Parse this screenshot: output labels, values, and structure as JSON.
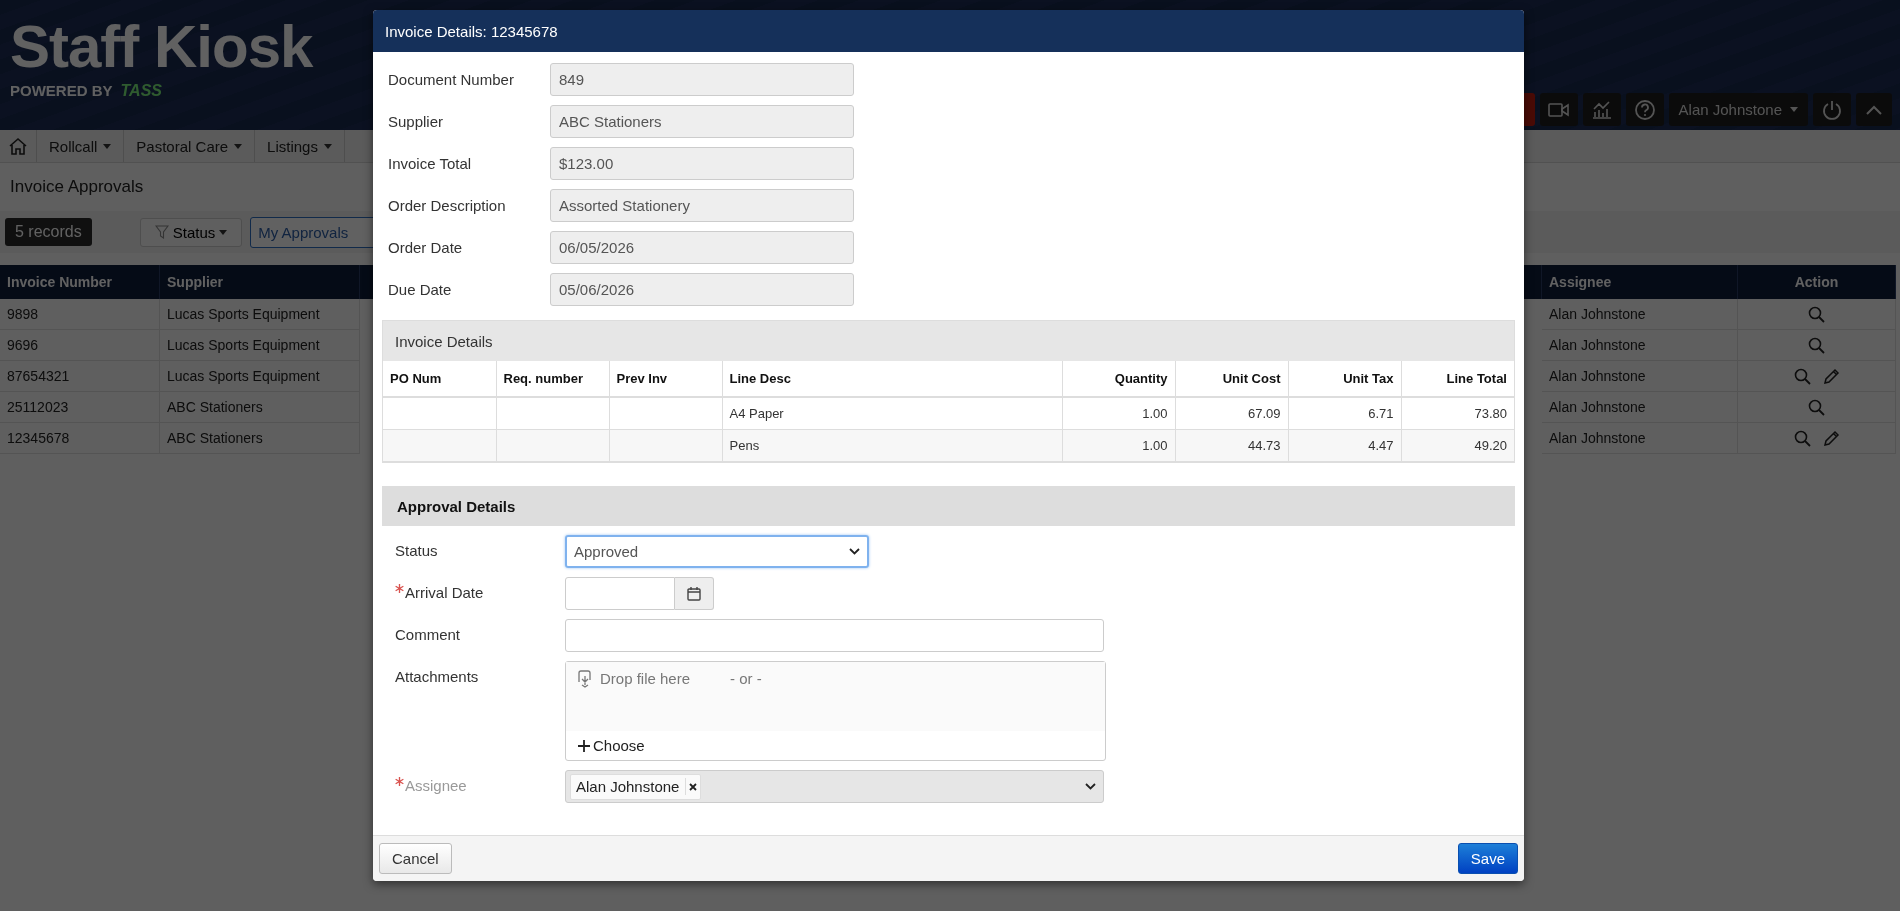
{
  "header": {
    "logo": "Staff Kiosk",
    "tagline": "POWERED BY",
    "brand": "TASS",
    "user": "Alan Johnstone"
  },
  "nav": [
    {
      "label": "Rollcall"
    },
    {
      "label": "Pastoral Care"
    },
    {
      "label": "Listings"
    }
  ],
  "page": {
    "title": "Invoice Approvals",
    "record_count": "5 records",
    "filter": "Status",
    "view": "My Approvals"
  },
  "table": {
    "columns": [
      "Invoice Number",
      "Supplier",
      "Assignee",
      "Action"
    ],
    "rows": [
      {
        "invoice": "9898",
        "supplier": "Lucas Sports Equipment",
        "assignee": "Alan Johnstone",
        "editable": false
      },
      {
        "invoice": "9696",
        "supplier": "Lucas Sports Equipment",
        "assignee": "Alan Johnstone",
        "editable": false
      },
      {
        "invoice": "87654321",
        "supplier": "Lucas Sports Equipment",
        "assignee": "Alan Johnstone",
        "editable": true
      },
      {
        "invoice": "25112023",
        "supplier": "ABC Stationers",
        "assignee": "Alan Johnstone",
        "editable": false
      },
      {
        "invoice": "12345678",
        "supplier": "ABC Stationers",
        "assignee": "Alan Johnstone",
        "editable": true
      }
    ]
  },
  "dialog": {
    "title": "Invoice Details: 12345678",
    "fields": [
      {
        "label": "Document Number",
        "value": "849"
      },
      {
        "label": "Supplier",
        "value": "ABC Stationers"
      },
      {
        "label": "Invoice Total",
        "value": "$123.00"
      },
      {
        "label": "Order Description",
        "value": "Assorted Stationery"
      },
      {
        "label": "Order Date",
        "value": "06/05/2026"
      },
      {
        "label": "Due Date",
        "value": "05/06/2026"
      }
    ],
    "invoice_details": {
      "title": "Invoice Details",
      "columns": [
        {
          "label": "PO Num",
          "kind": "text"
        },
        {
          "label": "Req. number",
          "kind": "text"
        },
        {
          "label": "Prev Inv",
          "kind": "text"
        },
        {
          "label": "Line Desc",
          "kind": "text"
        },
        {
          "label": "Quantity",
          "kind": "number"
        },
        {
          "label": "Unit Cost",
          "kind": "number"
        },
        {
          "label": "Unit Tax",
          "kind": "number"
        },
        {
          "label": "Line Total",
          "kind": "number"
        }
      ],
      "rows": [
        [
          null,
          null,
          null,
          "A4 Paper",
          "1.00",
          "67.09",
          "6.71",
          "73.80"
        ],
        [
          null,
          null,
          null,
          "Pens",
          "1.00",
          "44.73",
          "4.47",
          "49.20"
        ]
      ]
    },
    "approval": {
      "title": "Approval Details",
      "fields": [
        {
          "kind": "select",
          "label": "Status",
          "value": "Approved",
          "required": false,
          "focused": true,
          "disabled": false
        },
        {
          "kind": "date",
          "label": "Arrival Date",
          "required": true,
          "disabled": false
        },
        {
          "kind": "text",
          "label": "Comment",
          "required": false,
          "disabled": false
        },
        {
          "kind": "upload",
          "label": "Attachments",
          "drop_text": "Drop file here",
          "separator": "- or -",
          "button": "Choose",
          "required": false,
          "disabled": false
        },
        {
          "kind": "tags",
          "label": "Assignee",
          "tags": [
            "Alan Johnstone"
          ],
          "required": true,
          "disabled": true
        }
      ]
    },
    "buttons": [
      {
        "label": "Cancel",
        "kind": "secondary"
      },
      {
        "label": "Save",
        "kind": "primary"
      }
    ]
  }
}
